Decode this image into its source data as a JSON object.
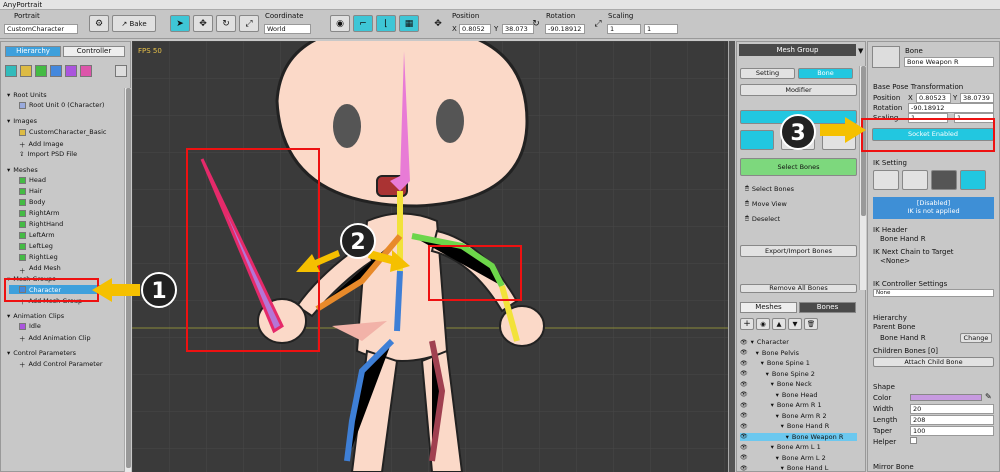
{
  "app": {
    "title": "AnyPortrait"
  },
  "toolbar": {
    "portrait_label": "Portrait",
    "portrait_value": "CustomCharacter",
    "bake_label": "Bake",
    "coordinate_label": "Coordinate",
    "coordinate_value": "World",
    "position_label": "Position",
    "pos_x_label": "X",
    "pos_x": "0.8052",
    "pos_y_label": "Y",
    "pos_y": "38.073",
    "rotation_label": "Rotation",
    "rotation_value": "-90.18912",
    "scaling_label": "Scaling",
    "scale_x": "1",
    "scale_y": "1"
  },
  "left": {
    "tabs": [
      "Hierarchy",
      "Controller"
    ],
    "root_units_header": "Root Units",
    "root_unit": "Root Unit 0 (Character)",
    "images_header": "Images",
    "images": [
      "CustomCharacter_Basic",
      "Add Image",
      "Import PSD File"
    ],
    "meshes_header": "Meshes",
    "meshes": [
      "Head",
      "Hair",
      "Body",
      "RightArm",
      "RightHand",
      "LeftArm",
      "LeftLeg",
      "RightLeg",
      "Add Mesh"
    ],
    "mesh_groups_header": "Mesh Groups",
    "mesh_groups": [
      "Character",
      "Add Mesh Group"
    ],
    "anim_header": "Animation Clips",
    "anims": [
      "Idle",
      "Add Animation Clip"
    ],
    "params_header": "Control Parameters",
    "params": [
      "Add Control Parameter"
    ]
  },
  "viewport": {
    "fps": "FPS 50"
  },
  "mid": {
    "title": "Mesh Group",
    "tabs": [
      "Setting",
      "Bone"
    ],
    "modifier": "Modifier",
    "select_bones": "Select Bones",
    "items": [
      "Select Bones",
      "Move View",
      "Deselect"
    ],
    "export_import": "Export/Import Bones",
    "remove_all": "Remove All Bones",
    "lower_tabs": [
      "Meshes",
      "Bones"
    ],
    "bones": [
      "Character",
      "Bone Pelvis",
      "Bone Spine 1",
      "Bone Spine 2",
      "Bone Neck",
      "Bone Head",
      "Bone Arm R 1",
      "Bone Arm R 2",
      "Bone Hand R",
      "Bone Weapon R",
      "Bone Arm L 1",
      "Bone Arm L 2",
      "Bone Hand L"
    ]
  },
  "right": {
    "bone_label": "Bone",
    "bone_name": "Bone Weapon R",
    "base_pose": "Base Pose Transformation",
    "position_label": "Position",
    "x_label": "X",
    "pos_x": "0.80523",
    "y_label": "Y",
    "pos_y": "38.0739",
    "rotation_label": "Rotation",
    "rotation": "-90.18912",
    "scaling_label": "Scaling",
    "scale_x": "1",
    "scale_y": "1",
    "socket_button": "Socket Enabled",
    "ik_setting": "IK Setting",
    "ik_disabled": "[Disabled]",
    "ik_not_applied": "IK is not applied",
    "ik_header_label": "IK Header",
    "ik_header_value": "Bone Hand R",
    "ik_next_label": "IK Next Chain to Target",
    "ik_next_value": "<None>",
    "ik_ctrl_label": "IK Controller Settings",
    "ik_ctrl_value": "None",
    "hierarchy_label": "Hierarchy",
    "parent_label": "Parent Bone",
    "parent_value": "Bone Hand R",
    "change_button": "Change",
    "children_label": "Children Bones [0]",
    "attach_button": "Attach Child Bone",
    "shape_label": "Shape",
    "color_label": "Color",
    "width_label": "Width",
    "width_value": "20",
    "length_label": "Length",
    "length_value": "208",
    "taper_label": "Taper",
    "taper_value": "100",
    "helper_label": "Helper",
    "mirror_label": "Mirror Bone"
  },
  "callouts": [
    "1",
    "2",
    "3"
  ],
  "colors": {
    "accent": "#3ec6d6",
    "highlight": "#e11111",
    "arrow": "#f5c000"
  }
}
